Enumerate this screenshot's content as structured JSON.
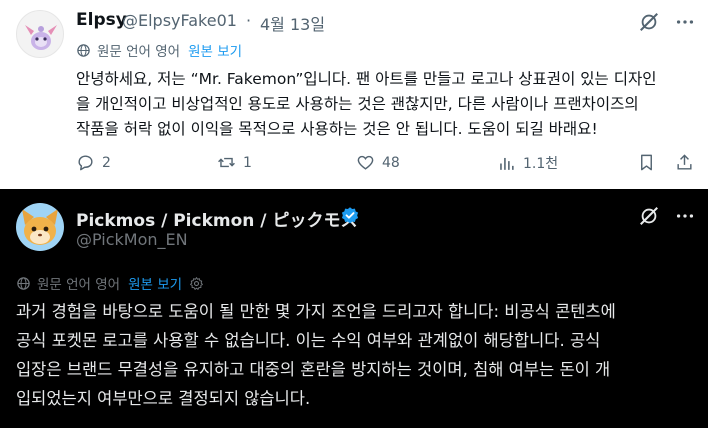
{
  "post1": {
    "author_name": "Elpsy",
    "author_handle": "@ElpsyFake01",
    "separator": "·",
    "date": "4월 13일",
    "translation_note": "원문 언어 영어",
    "translation_link": "원본 보기",
    "body_lines": [
      "안녕하세요, 저는 “Mr. Fakemon”입니다. 팬 아트를 만들고 로고나 상표권이 있는 디자인",
      "을 개인적이고 비상업적인 용도로 사용하는 것은 괜찮지만, 다른 사람이나 프랜차이즈의",
      "작품을 허락 없이 이익을 목적으로 사용하는 것은 안 됩니다. 도움이 되길 바래요!"
    ],
    "actions": {
      "reply_count": "2",
      "repost_count": "1",
      "like_count": "48",
      "view_count": "1.1천"
    }
  },
  "post2": {
    "author_name": "Pickmos / Pickmon / ピックモス",
    "author_handle": "@PickMon_EN",
    "translation_note": "원문 언어 영어",
    "translation_link": "원본 보기",
    "body_lines": [
      "과거 경험을 바탕으로 도움이 될 만한 몇 가지 조언을 드리고자 합니다: 비공식 콘텐츠에",
      "공식 포켓몬 로고를 사용할 수 없습니다. 이는 수익 여부와 관계없이 해당합니다. 공식",
      "입장은 브랜드 무결성을 유지하고 대중의 혼란을 방지하는 것이며, 침해 여부는 돈이 개",
      "입되었는지 여부만으로 결정되지 않습니다."
    ]
  },
  "colors": {
    "accent": "#1d9bf0",
    "verified": "#1d9bf0",
    "muted_light": "#536471",
    "muted_dark": "#71767b"
  },
  "icons": [
    "grok-icon",
    "more-icon",
    "globe-icon",
    "reply-icon",
    "repost-icon",
    "like-icon",
    "views-icon",
    "bookmark-icon",
    "share-icon",
    "verified-badge-icon",
    "gear-icon"
  ]
}
